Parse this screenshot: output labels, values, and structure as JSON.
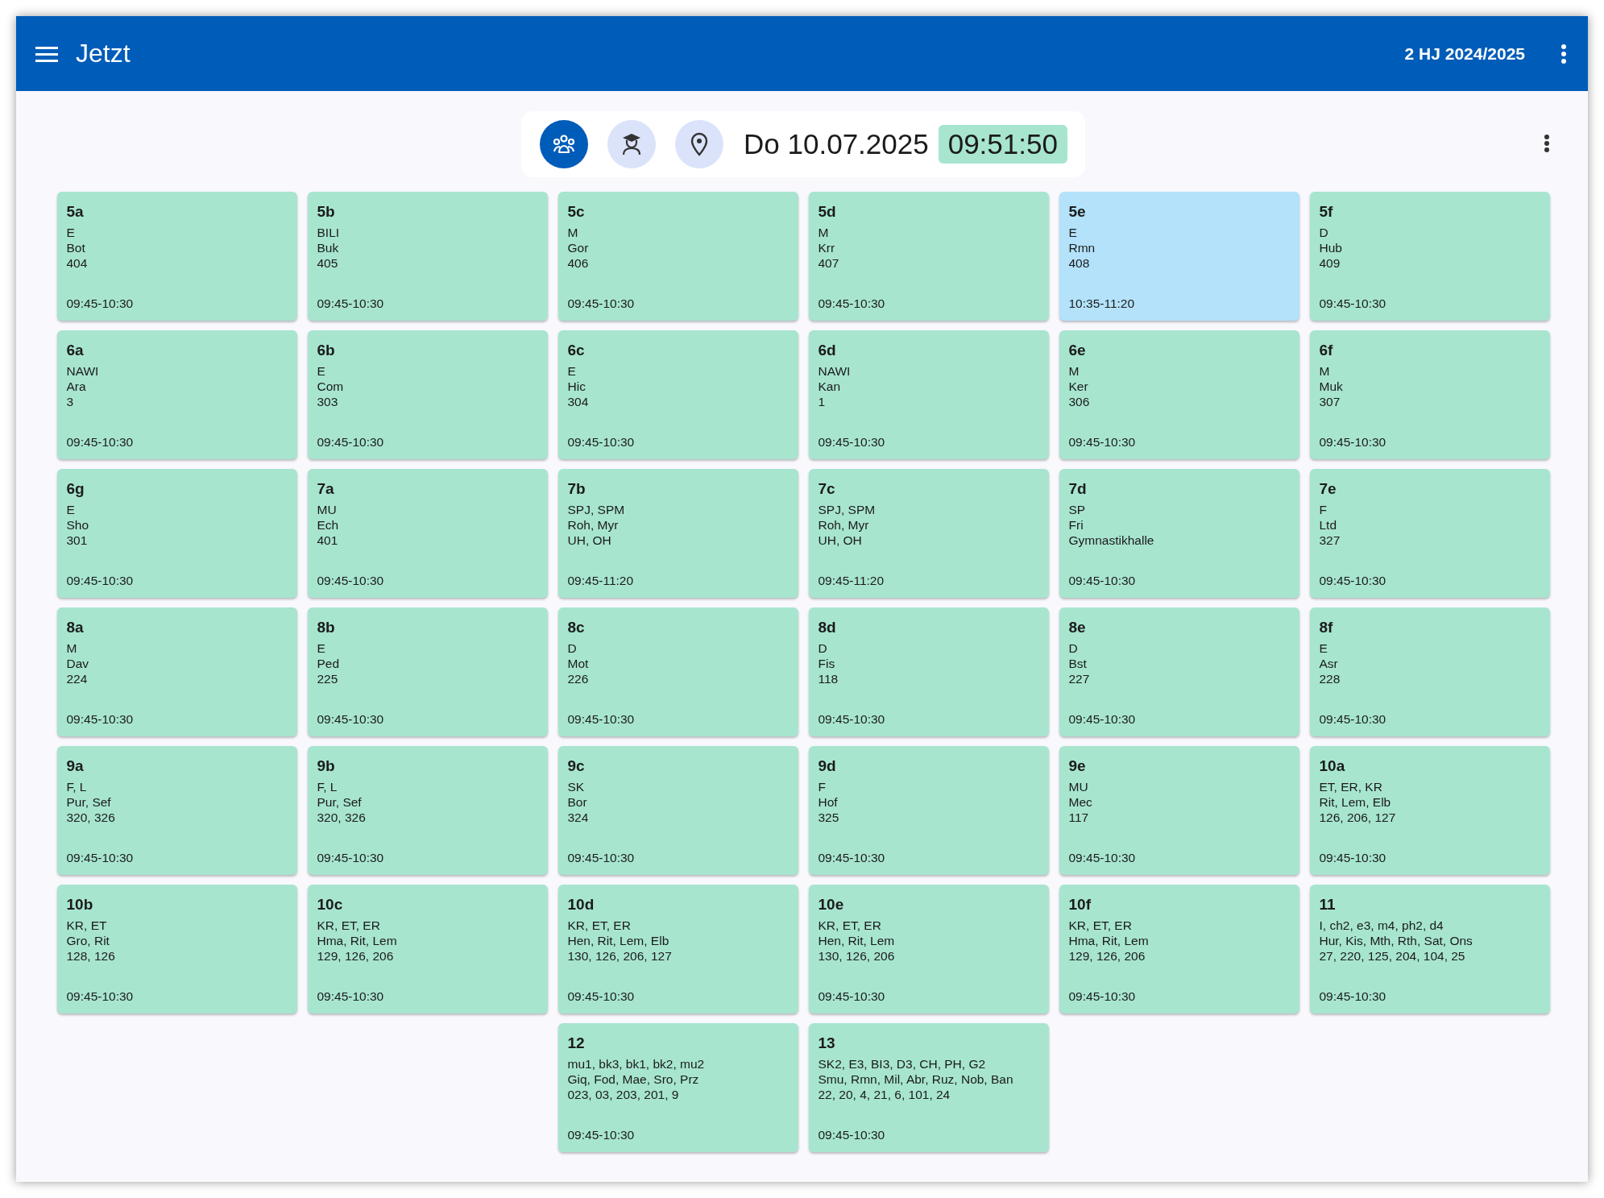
{
  "app_bar": {
    "title": "Jetzt",
    "term": "2 HJ 2024/2025"
  },
  "toolbar": {
    "views": [
      {
        "kind": "classes",
        "selected": true
      },
      {
        "kind": "teachers",
        "selected": false
      },
      {
        "kind": "rooms",
        "selected": false
      }
    ],
    "date": "Do 10.07.2025",
    "time": "09:51:50"
  },
  "cards": [
    {
      "class": "5a",
      "lines": [
        "E",
        "Bot",
        "404"
      ],
      "time": "09:45-10:30",
      "color": "#a7e5cf"
    },
    {
      "class": "5b",
      "lines": [
        "BILI",
        "Buk",
        "405"
      ],
      "time": "09:45-10:30",
      "color": "#a7e5cf"
    },
    {
      "class": "5c",
      "lines": [
        "M",
        "Gor",
        "406"
      ],
      "time": "09:45-10:30",
      "color": "#a7e5cf"
    },
    {
      "class": "5d",
      "lines": [
        "M",
        "Krr",
        "407"
      ],
      "time": "09:45-10:30",
      "color": "#a7e5cf"
    },
    {
      "class": "5e",
      "lines": [
        "E",
        "Rmn",
        "408"
      ],
      "time": "10:35-11:20",
      "color": "#b3e2fa"
    },
    {
      "class": "5f",
      "lines": [
        "D",
        "Hub",
        "409"
      ],
      "time": "09:45-10:30",
      "color": "#a7e5cf"
    },
    {
      "class": "6a",
      "lines": [
        "NAWI",
        "Ara",
        "3"
      ],
      "time": "09:45-10:30",
      "color": "#a7e5cf"
    },
    {
      "class": "6b",
      "lines": [
        "E",
        "Com",
        "303"
      ],
      "time": "09:45-10:30",
      "color": "#a7e5cf"
    },
    {
      "class": "6c",
      "lines": [
        "E",
        "Hic",
        "304"
      ],
      "time": "09:45-10:30",
      "color": "#a7e5cf"
    },
    {
      "class": "6d",
      "lines": [
        "NAWI",
        "Kan",
        "1"
      ],
      "time": "09:45-10:30",
      "color": "#a7e5cf"
    },
    {
      "class": "6e",
      "lines": [
        "M",
        "Ker",
        "306"
      ],
      "time": "09:45-10:30",
      "color": "#a7e5cf"
    },
    {
      "class": "6f",
      "lines": [
        "M",
        "Muk",
        "307"
      ],
      "time": "09:45-10:30",
      "color": "#a7e5cf"
    },
    {
      "class": "6g",
      "lines": [
        "E",
        "Sho",
        "301"
      ],
      "time": "09:45-10:30",
      "color": "#a7e5cf"
    },
    {
      "class": "7a",
      "lines": [
        "MU",
        "Ech",
        "401"
      ],
      "time": "09:45-10:30",
      "color": "#a7e5cf"
    },
    {
      "class": "7b",
      "lines": [
        "SPJ, SPM",
        "Roh, Myr",
        "UH, OH"
      ],
      "time": "09:45-11:20",
      "color": "#a7e5cf"
    },
    {
      "class": "7c",
      "lines": [
        "SPJ, SPM",
        "Roh, Myr",
        "UH, OH"
      ],
      "time": "09:45-11:20",
      "color": "#a7e5cf"
    },
    {
      "class": "7d",
      "lines": [
        "SP",
        "Fri",
        "Gymnastikhalle"
      ],
      "time": "09:45-10:30",
      "color": "#a7e5cf"
    },
    {
      "class": "7e",
      "lines": [
        "F",
        "Ltd",
        "327"
      ],
      "time": "09:45-10:30",
      "color": "#a7e5cf"
    },
    {
      "class": "8a",
      "lines": [
        "M",
        "Dav",
        "224"
      ],
      "time": "09:45-10:30",
      "color": "#a7e5cf"
    },
    {
      "class": "8b",
      "lines": [
        "E",
        "Ped",
        "225"
      ],
      "time": "09:45-10:30",
      "color": "#a7e5cf"
    },
    {
      "class": "8c",
      "lines": [
        "D",
        "Mot",
        "226"
      ],
      "time": "09:45-10:30",
      "color": "#a7e5cf"
    },
    {
      "class": "8d",
      "lines": [
        "D",
        "Fis",
        "118"
      ],
      "time": "09:45-10:30",
      "color": "#a7e5cf"
    },
    {
      "class": "8e",
      "lines": [
        "D",
        "Bst",
        "227"
      ],
      "time": "09:45-10:30",
      "color": "#a7e5cf"
    },
    {
      "class": "8f",
      "lines": [
        "E",
        "Asr",
        "228"
      ],
      "time": "09:45-10:30",
      "color": "#a7e5cf"
    },
    {
      "class": "9a",
      "lines": [
        "F, L",
        "Pur, Sef",
        "320, 326"
      ],
      "time": "09:45-10:30",
      "color": "#a7e5cf"
    },
    {
      "class": "9b",
      "lines": [
        "F, L",
        "Pur, Sef",
        "320, 326"
      ],
      "time": "09:45-10:30",
      "color": "#a7e5cf"
    },
    {
      "class": "9c",
      "lines": [
        "SK",
        "Bor",
        "324"
      ],
      "time": "09:45-10:30",
      "color": "#a7e5cf"
    },
    {
      "class": "9d",
      "lines": [
        "F",
        "Hof",
        "325"
      ],
      "time": "09:45-10:30",
      "color": "#a7e5cf"
    },
    {
      "class": "9e",
      "lines": [
        "MU",
        "Mec",
        "117"
      ],
      "time": "09:45-10:30",
      "color": "#a7e5cf"
    },
    {
      "class": "10a",
      "lines": [
        "ET, ER, KR",
        "Rit, Lem, Elb",
        "126, 206, 127"
      ],
      "time": "09:45-10:30",
      "color": "#a7e5cf"
    },
    {
      "class": "10b",
      "lines": [
        "KR, ET",
        "Gro, Rit",
        "128, 126"
      ],
      "time": "09:45-10:30",
      "color": "#a7e5cf"
    },
    {
      "class": "10c",
      "lines": [
        "KR, ET, ER",
        "Hma, Rit, Lem",
        "129, 126, 206"
      ],
      "time": "09:45-10:30",
      "color": "#a7e5cf"
    },
    {
      "class": "10d",
      "lines": [
        "KR, ET, ER",
        "Hen, Rit, Lem, Elb",
        "130, 126, 206, 127"
      ],
      "time": "09:45-10:30",
      "color": "#a7e5cf"
    },
    {
      "class": "10e",
      "lines": [
        "KR, ET, ER",
        "Hen, Rit, Lem",
        "130, 126, 206"
      ],
      "time": "09:45-10:30",
      "color": "#a7e5cf"
    },
    {
      "class": "10f",
      "lines": [
        "KR, ET, ER",
        "Hma, Rit, Lem",
        "129, 126, 206"
      ],
      "time": "09:45-10:30",
      "color": "#a7e5cf"
    },
    {
      "class": "11",
      "lines": [
        "I, ch2, e3, m4, ph2, d4",
        "Hur, Kis, Mth, Rth, Sat, Ons",
        "27, 220, 125, 204, 104, 25"
      ],
      "time": "09:45-10:30",
      "color": "#a7e5cf"
    },
    {
      "class": "12",
      "lines": [
        "mu1, bk3, bk1, bk2, mu2",
        "Giq, Fod, Mae, Sro, Prz",
        "023, 03, 203, 201, 9"
      ],
      "time": "09:45-10:30",
      "color": "#a7e5cf"
    },
    {
      "class": "13",
      "lines": [
        "SK2, E3, BI3, D3, CH, PH, G2",
        "Smu, Rmn, Mil, Abr, Ruz, Nob, Ban",
        "22, 20, 4, 21, 6, 101, 24"
      ],
      "time": "09:45-10:30",
      "color": "#a7e5cf"
    }
  ]
}
